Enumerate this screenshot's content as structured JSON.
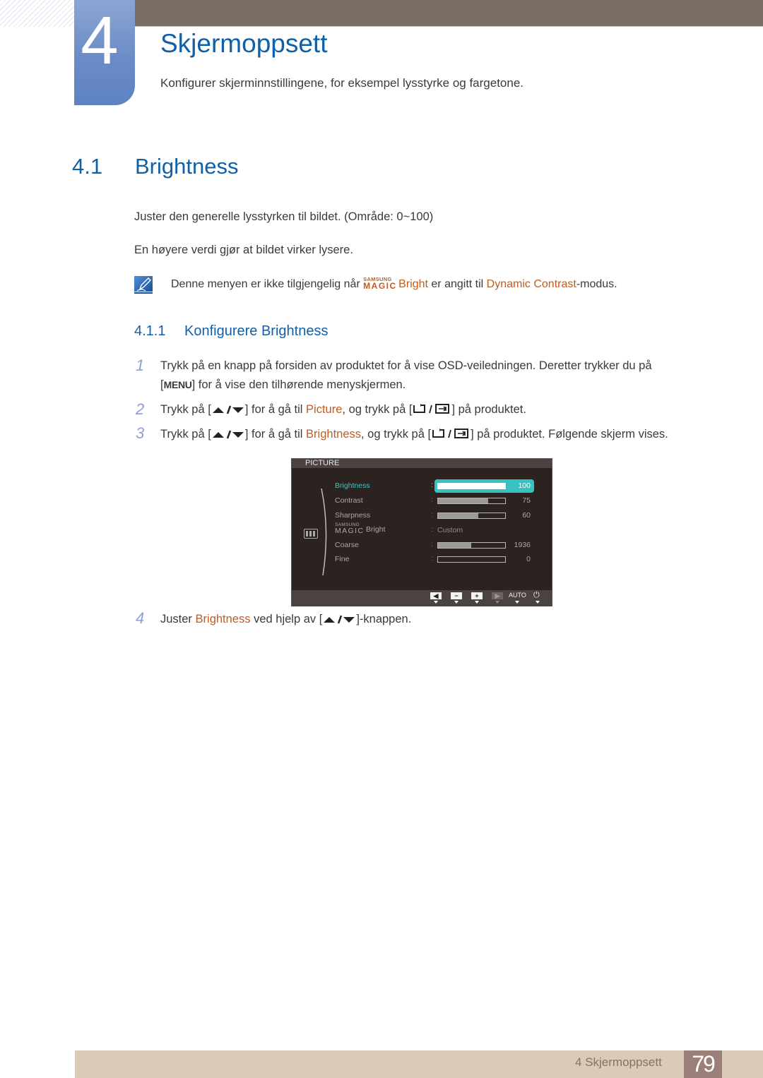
{
  "chapter": {
    "number": "4",
    "title": "Skjermoppsett",
    "subtitle": "Konfigurer skjerminnstillingene, for eksempel lysstyrke og fargetone."
  },
  "section": {
    "number": "4.1",
    "title": "Brightness",
    "para1": "Juster den generelle lysstyrken til bildet. (Område: 0~100)",
    "para2": "En høyere verdi gjør at bildet virker lysere.",
    "note": {
      "icon": "note-pencil-icon",
      "before": "Denne menyen er ikke tilgjengelig når ",
      "magic_top": "SAMSUNG",
      "magic_bottom": "MAGIC",
      "bright": "Bright",
      "middle": " er angitt til ",
      "mode": "Dynamic Contrast",
      "after": "-modus."
    }
  },
  "subsection": {
    "number": "4.1.1",
    "title": "Konfigurere Brightness"
  },
  "steps": [
    {
      "num": "1",
      "line1": "Trykk på en knapp på forsiden av produktet for å vise OSD-veiledningen. Deretter trykker du på",
      "line2_open": "[",
      "line2_key": "MENU",
      "line2_rest": "] for å vise den tilhørende menyskjermen."
    },
    {
      "num": "2",
      "a": "Trykk på [",
      "b": "] for å gå til ",
      "target": "Picture",
      "c": ", og trykk på [",
      "d": "] på produktet."
    },
    {
      "num": "3",
      "a": "Trykk på [",
      "b": "] for å gå til ",
      "target": "Brightness",
      "c": ", og trykk på [",
      "d": "] på produktet. Følgende skjerm vises."
    },
    {
      "num": "4",
      "a": "Juster ",
      "target": "Brightness",
      "b": " ved hjelp av [",
      "c": "]-knappen."
    }
  ],
  "osd": {
    "title": "PICTURE",
    "items": [
      {
        "label": "Brightness",
        "value": "100",
        "fill": 1.0,
        "active": true
      },
      {
        "label": "Contrast",
        "value": "75",
        "fill": 0.75
      },
      {
        "label": "Sharpness",
        "value": "60",
        "fill": 0.6
      },
      {
        "label_top": "SAMSUNG",
        "label_magic": "MAGIC",
        "label_bright": "Bright",
        "text_value": "Custom"
      },
      {
        "label": "Coarse",
        "value": "1936",
        "fill": 0.49
      },
      {
        "label": "Fine",
        "value": "0",
        "fill": 0.0
      }
    ],
    "buttons": [
      {
        "icon": "left-arrow-icon",
        "glyph": "◀"
      },
      {
        "icon": "minus-icon",
        "glyph": "−"
      },
      {
        "icon": "plus-icon",
        "glyph": "+"
      },
      {
        "icon": "right-arrow-icon",
        "glyph": "▶",
        "dim": true
      },
      {
        "icon": "auto-label",
        "label": "AUTO"
      },
      {
        "icon": "power-icon",
        "glyph": "⏻"
      }
    ]
  },
  "footer": {
    "label": "4 Skjermoppsett",
    "page": "79"
  },
  "colors": {
    "heading_blue": "#1060a8",
    "accent_orange": "#c25b1f",
    "osd_highlight": "#36c2c0",
    "topbar": "#7b6e62",
    "footer_bg": "#d9cbb8",
    "page_box": "#9b8079"
  }
}
